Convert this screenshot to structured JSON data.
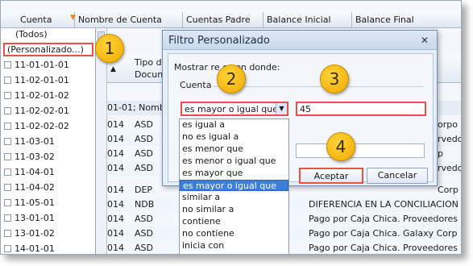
{
  "grid": {
    "headers": [
      "Cuenta",
      "Nombre de Cuenta",
      "Cuentas Padre",
      "Balance Inicial",
      "Balance Final"
    ],
    "sub_headers": [
      "Tipo d",
      "Docun"
    ],
    "group_row": "01-01; Nomb",
    "rows": [
      {
        "c1": "014",
        "c2": "ASD",
        "tail": "orpo"
      },
      {
        "c1": "014",
        "c2": "ASD",
        "tail": "rvedo"
      },
      {
        "c1": "014",
        "c2": "ASD",
        "tail": "p"
      },
      {
        "c1": "014",
        "c2": "ASD",
        "tail": "rvedo"
      },
      {
        "c1": "014",
        "c2": "DEP",
        "tail": "Corp"
      },
      {
        "c1": "014",
        "c2": "NDB",
        "tail": "DIFERENCIA EN LA CONCILIACION"
      },
      {
        "c1": "014",
        "c2": "ASD",
        "tail": "Pago por Caja Chica. Proveedores V"
      },
      {
        "c1": "014",
        "c2": "ASD",
        "tail": "Pago por Caja Chica. Galaxy Corp"
      },
      {
        "c1": "014",
        "c2": "ASD",
        "tail": "Pago por Caja Chica. Proveedores V"
      }
    ]
  },
  "filter_list": {
    "todos": "(Todos)",
    "personalizado": "(Personalizado...)",
    "items": [
      "11-01-01-01",
      "11-02-01-01",
      "11-02-01-02",
      "11-02-02-01",
      "11-02-02-02",
      "11-03-01",
      "11-03-02",
      "11-04-01",
      "11-04-02",
      "11-05-01",
      "13-01-01",
      "13-01-02",
      "14-01-01"
    ]
  },
  "dialog": {
    "title": "Filtro Personalizado",
    "close": "✕",
    "prompt": "Mostrar re          es en donde:",
    "field_label": "Cuenta",
    "operator_value": "es mayor o igual que",
    "value": "45",
    "second_value": "",
    "ok_label": "Aceptar",
    "cancel_label": "Cancelar"
  },
  "operators": [
    "es igual a",
    "no es igual a",
    "es menor que",
    "es menor o igual que",
    "es mayor que",
    "es mayor o igual que",
    "similar a",
    "no similar a",
    "contiene",
    "no contiene",
    "inicia con"
  ],
  "selected_operator_index": 5,
  "callouts": [
    "1",
    "2",
    "3",
    "4"
  ],
  "colors": {
    "highlight_red": "#e8504a",
    "badge_yellow": "#f5b800",
    "selection_blue": "#3d7fd6"
  }
}
